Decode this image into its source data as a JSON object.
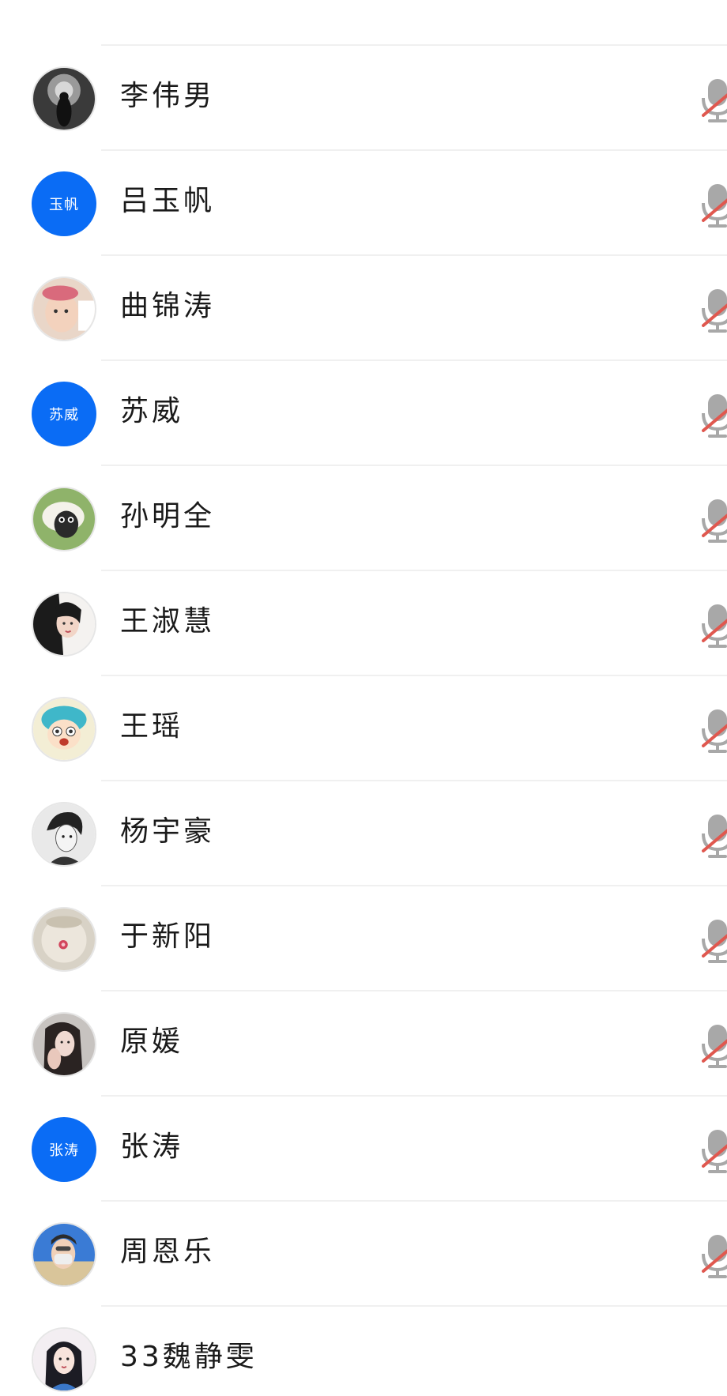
{
  "participants": [
    {
      "name": "李伟男",
      "avatar": {
        "type": "image",
        "icon": "silhouette-avatar"
      },
      "mic": "muted-mic-icon"
    },
    {
      "name": "吕玉帆",
      "avatar": {
        "type": "initials",
        "text": "玉帆",
        "color": "#0a6cf5"
      },
      "mic": "muted-mic-icon"
    },
    {
      "name": "曲锦涛",
      "avatar": {
        "type": "image",
        "icon": "child-photo-avatar"
      },
      "mic": "muted-mic-icon"
    },
    {
      "name": "苏威",
      "avatar": {
        "type": "initials",
        "text": "苏威",
        "color": "#0a6cf5"
      },
      "mic": "muted-mic-icon"
    },
    {
      "name": "孙明全",
      "avatar": {
        "type": "image",
        "icon": "sheep-cartoon-avatar"
      },
      "mic": "muted-mic-icon"
    },
    {
      "name": "王淑慧",
      "avatar": {
        "type": "image",
        "icon": "woman-photo-avatar"
      },
      "mic": "muted-mic-icon"
    },
    {
      "name": "王瑶",
      "avatar": {
        "type": "image",
        "icon": "cartoon-girl-avatar"
      },
      "mic": "muted-mic-icon"
    },
    {
      "name": "杨宇豪",
      "avatar": {
        "type": "image",
        "icon": "anime-boy-avatar"
      },
      "mic": "muted-mic-icon"
    },
    {
      "name": "于新阳",
      "avatar": {
        "type": "image",
        "icon": "cup-photo-avatar"
      },
      "mic": "muted-mic-icon"
    },
    {
      "name": "原媛",
      "avatar": {
        "type": "image",
        "icon": "girl-photo-avatar"
      },
      "mic": "muted-mic-icon"
    },
    {
      "name": "张涛",
      "avatar": {
        "type": "initials",
        "text": "张涛",
        "color": "#0a6cf5"
      },
      "mic": "muted-mic-icon"
    },
    {
      "name": "周恩乐",
      "avatar": {
        "type": "image",
        "icon": "masked-man-avatar"
      },
      "mic": "muted-mic-icon"
    },
    {
      "name": "33魏静雯",
      "avatar": {
        "type": "image",
        "icon": "princess-avatar"
      },
      "mic": ""
    }
  ],
  "colors": {
    "accent": "#0a6cf5",
    "mute_slash": "#e0584f",
    "mic_gray": "#a8a8a8",
    "divider": "#f0f0f0"
  }
}
